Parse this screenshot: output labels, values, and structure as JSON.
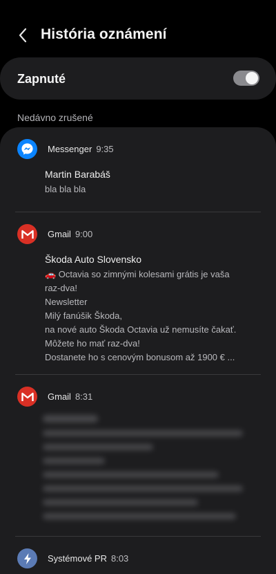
{
  "header": {
    "title": "História oznámení"
  },
  "toggle": {
    "label": "Zapnuté",
    "on": true
  },
  "section": {
    "label": "Nedávno zrušené"
  },
  "notifications": [
    {
      "app": "Messenger",
      "time": "9:35",
      "icon": "messenger-icon",
      "title": "Martin Barabáš",
      "body": [
        "bla bla bla"
      ]
    },
    {
      "app": "Gmail",
      "time": "9:00",
      "icon": "gmail-icon",
      "title": "Škoda Auto Slovensko",
      "body": [
        "🚗 Octavia so zimnými kolesami grátis je vaša",
        "raz-dva!",
        "Newsletter",
        "Milý fanúšik Škoda,",
        "na nové auto Škoda Octavia už nemusíte čakať.",
        "Môžete ho mať raz-dva!",
        "Dostanete ho s cenovým bonusom až 1900 € ..."
      ]
    },
    {
      "app": "Gmail",
      "time": "8:31",
      "icon": "gmail-icon",
      "title": "",
      "body": []
    },
    {
      "app": "Systémové PR",
      "time": "8:03",
      "icon": "lightning-icon",
      "title": "",
      "body": []
    }
  ],
  "colors": {
    "background": "#000000",
    "card": "#1d1d1f",
    "messenger_blue": "#0a84ff",
    "gmail_red": "#d93025",
    "system_blue": "#5b7bb5"
  }
}
